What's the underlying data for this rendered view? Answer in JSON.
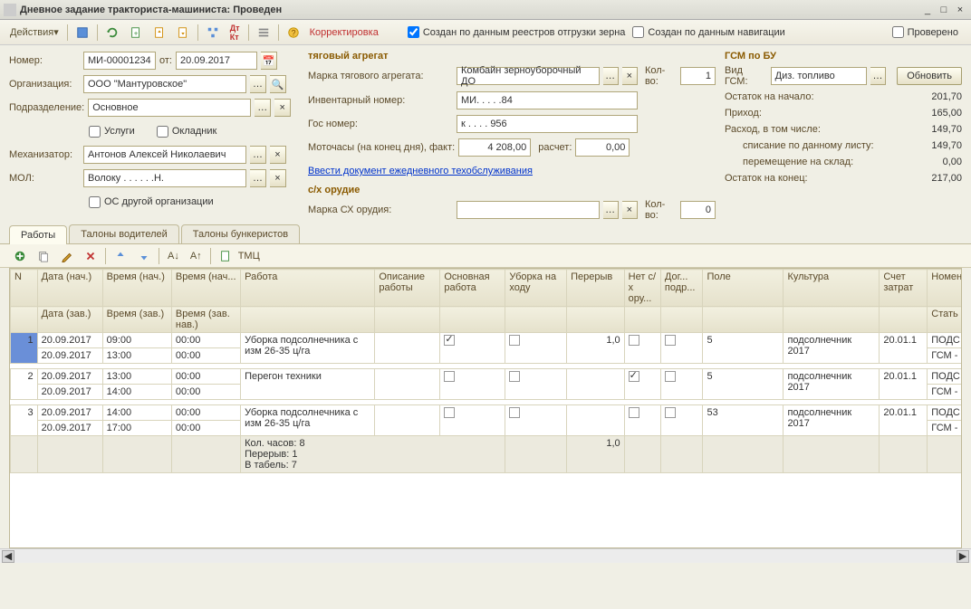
{
  "window": {
    "title": "Дневное задание тракториста-машиниста: Проведен"
  },
  "toolbar": {
    "actions": "Действия",
    "korrektirovka": "Корректировка",
    "chk_reestr": "Создан по данным реестров отгрузки зерна",
    "chk_nav": "Создан по данным навигации",
    "chk_provereno": "Проверено"
  },
  "form": {
    "nomer_lbl": "Номер:",
    "nomer": "МИ-00001234",
    "ot_lbl": "от:",
    "ot": "20.09.2017",
    "org_lbl": "Организация:",
    "org": "ООО \"Мантуровское\"",
    "podr_lbl": "Подразделение:",
    "podr": "Основное",
    "uslugi": "Услуги",
    "okladnik": "Окладник",
    "mech_lbl": "Механизатор:",
    "mech": "Антонов Алексей Николаевич",
    "mol_lbl": "МОЛ:",
    "mol": "Волоку . . . . . .Н.",
    "os_drugoy": "ОС другой организации",
    "tagr_hdr": "тяговый агрегат",
    "marka_lbl": "Марка тягового агрегата:",
    "marka": "Комбайн зерноуборочный ДО",
    "kolvo_lbl": "Кол-во:",
    "kolvo": "1",
    "inv_lbl": "Инвентарный номер:",
    "inv": "МИ. . . . .84",
    "gos_lbl": "Гос номер:",
    "gos": "к . . . . 956",
    "moto_lbl": "Моточасы (на конец дня), факт:",
    "moto": "4 208,00",
    "raschet_lbl": "расчет:",
    "raschet": "0,00",
    "link_to": "Ввести документ ежедневного техобслуживания",
    "sh_hdr": "с/х орудие",
    "marka_sh_lbl": "Марка СХ орудия:",
    "marka_sh": "",
    "kolvo_sh": "0",
    "gsm_hdr": "ГСМ по БУ",
    "vid_lbl": "Вид ГСМ:",
    "vid": "Диз. топливо",
    "obnovit": "Обновить",
    "ost_nach_lbl": "Остаток на начало:",
    "ost_nach": "201,70",
    "prihod_lbl": "Приход:",
    "prihod": "165,00",
    "rashod_lbl": "Расход,  в том числе:",
    "rashod": "149,70",
    "spisanie_lbl": "списание по данному листу:",
    "spisanie": "149,70",
    "perem_lbl": "перемещение на склад:",
    "perem": "0,00",
    "ost_kon_lbl": "Остаток на конец:",
    "ost_kon": "217,00"
  },
  "tabs": {
    "raboty": "Работы",
    "talony_vod": "Талоны водителей",
    "talony_bunk": "Талоны бункеристов"
  },
  "tabtoolbar": {
    "tmc": "ТМЦ"
  },
  "grid": {
    "cols": [
      "N",
      "Дата (нач.)",
      "Время (нач.)",
      "Время (нач...",
      "Работа",
      "Описание работы",
      "Основная работа",
      "Уборка на ходу",
      "Перерыв",
      "Нет с/х ору...",
      "Дог... подр...",
      "Поле",
      "Культура",
      "Счет затрат",
      "Номен"
    ],
    "cols2": [
      "",
      "Дата (зав.)",
      "Время (зав.)",
      "Время (зав. нав.)",
      "",
      "",
      "",
      "",
      "",
      "",
      "",
      "",
      "",
      "",
      "Стать"
    ],
    "rows": [
      {
        "n": "1",
        "d1": "20.09.2017",
        "t1": "09:00",
        "tn": "00:00",
        "d2": "20.09.2017",
        "t2": "13:00",
        "tn2": "00:00",
        "rabota": "Уборка подсолнечника с изм 26-35 ц/га",
        "osn": true,
        "ubor": false,
        "pere": "1,0",
        "net": false,
        "dog": false,
        "pole": "5",
        "kult": "подсолнечник 2017",
        "schet": "20.01.1",
        "nom": "ПОДС",
        "nom2": "ГСМ -"
      },
      {
        "n": "2",
        "d1": "20.09.2017",
        "t1": "13:00",
        "tn": "00:00",
        "d2": "20.09.2017",
        "t2": "14:00",
        "tn2": "00:00",
        "rabota": "Перегон техники",
        "osn": false,
        "ubor": false,
        "pere": "",
        "net": true,
        "dog": false,
        "pole": "5",
        "kult": "подсолнечник 2017",
        "schet": "20.01.1",
        "nom": "ПОДС",
        "nom2": "ГСМ -"
      },
      {
        "n": "3",
        "d1": "20.09.2017",
        "t1": "14:00",
        "tn": "00:00",
        "d2": "20.09.2017",
        "t2": "17:00",
        "tn2": "00:00",
        "rabota": "Уборка подсолнечника с изм 26-35 ц/га",
        "osn": false,
        "ubor": false,
        "pere": "",
        "net": false,
        "dog": false,
        "pole": "53",
        "kult": "подсолнечник 2017",
        "schet": "20.01.1",
        "nom": "ПОДС",
        "nom2": "ГСМ -"
      }
    ],
    "footer": {
      "kol": "Кол. часов: 8",
      "per": "Перерыв: 1",
      "tab": "В табель: 7",
      "sum_pere": "1,0"
    }
  }
}
